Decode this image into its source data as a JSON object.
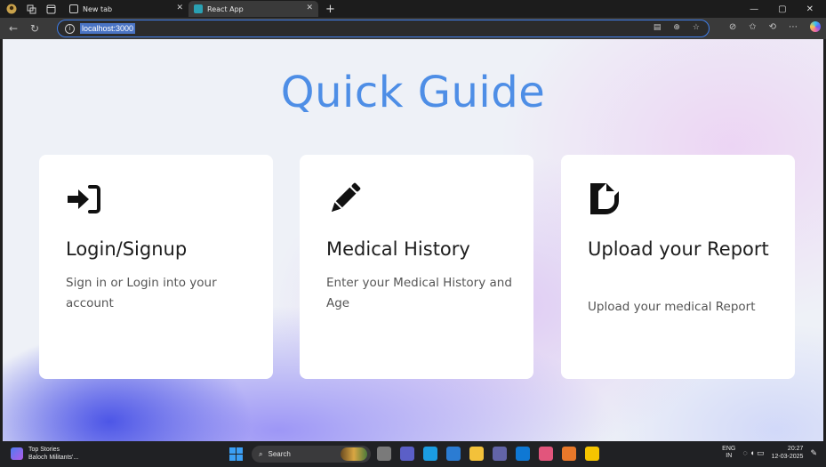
{
  "browser": {
    "tabs": [
      {
        "label": "New tab",
        "active": false
      },
      {
        "label": "React App",
        "active": true
      }
    ],
    "url": "localhost:3000"
  },
  "page": {
    "title": "Quick Guide",
    "accent_color": "#4e8ee6",
    "cards": [
      {
        "icon": "sign-in-icon",
        "title": "Login/Signup",
        "description": "Sign in or Login into your account"
      },
      {
        "icon": "pencil-icon",
        "title": "Medical History",
        "description": "Enter your Medical History and Age"
      },
      {
        "icon": "file-upload-icon",
        "title": "Upload your Report",
        "description": "Upload your medical Report"
      }
    ]
  },
  "taskbar": {
    "news_title": "Top Stories",
    "news_subtitle": "Baloch Militants'...",
    "search_placeholder": "Search",
    "lang_line1": "ENG",
    "lang_line2": "IN",
    "time": "20:27",
    "date": "12-03-2025"
  }
}
